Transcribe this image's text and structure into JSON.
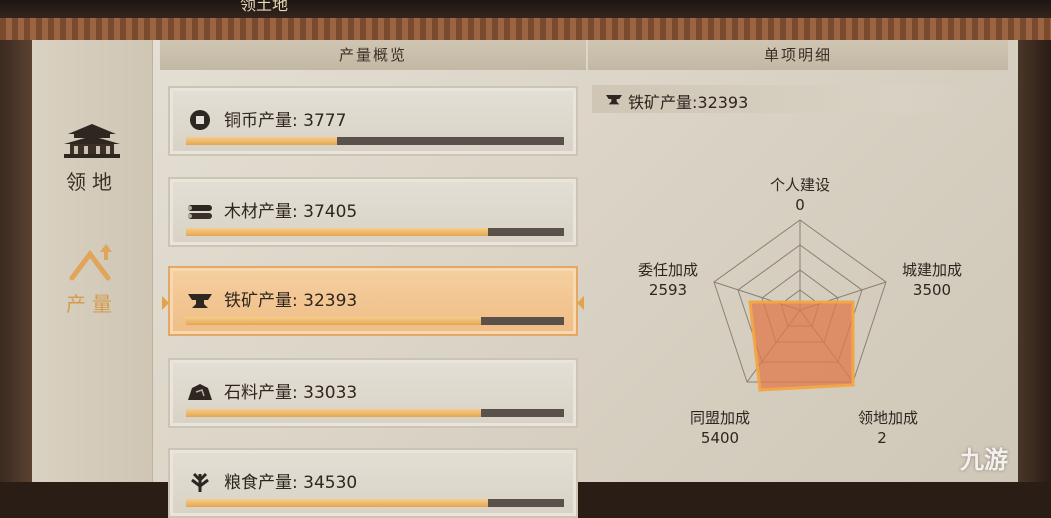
{
  "window": {
    "title": "领土地"
  },
  "sidebar": {
    "items": [
      {
        "label": "领地",
        "icon": "palace-icon",
        "active": false
      },
      {
        "label": "产量",
        "icon": "pickaxe-icon",
        "active": true
      }
    ]
  },
  "overview": {
    "header": "产量概览",
    "items": [
      {
        "label": "铜币产量: ",
        "value": "3777",
        "progress": 0.4,
        "icon": "coin-icon"
      },
      {
        "label": "木材产量: ",
        "value": "37405",
        "progress": 0.8,
        "icon": "wood-icon"
      },
      {
        "label": "铁矿产量: ",
        "value": "32393",
        "progress": 0.78,
        "icon": "anvil-icon"
      },
      {
        "label": "石料产量: ",
        "value": "33033",
        "progress": 0.78,
        "icon": "stone-icon"
      },
      {
        "label": "粮食产量: ",
        "value": "34530",
        "progress": 0.8,
        "icon": "grain-icon"
      }
    ]
  },
  "detail": {
    "header": "单项明细",
    "title": "铁矿产量:32393",
    "radar": [
      {
        "label": "个人建设",
        "value": "0"
      },
      {
        "label": "城建加成",
        "value": "3500"
      },
      {
        "label": "领地加成",
        "value": "2"
      },
      {
        "label": "同盟加成",
        "value": "5400"
      },
      {
        "label": "委任加成",
        "value": "2593"
      }
    ]
  },
  "watermark": "九游",
  "colors": {
    "accent": "#e4a654",
    "radar_fill": "#e0784a",
    "bar_track": "#5a524a"
  }
}
